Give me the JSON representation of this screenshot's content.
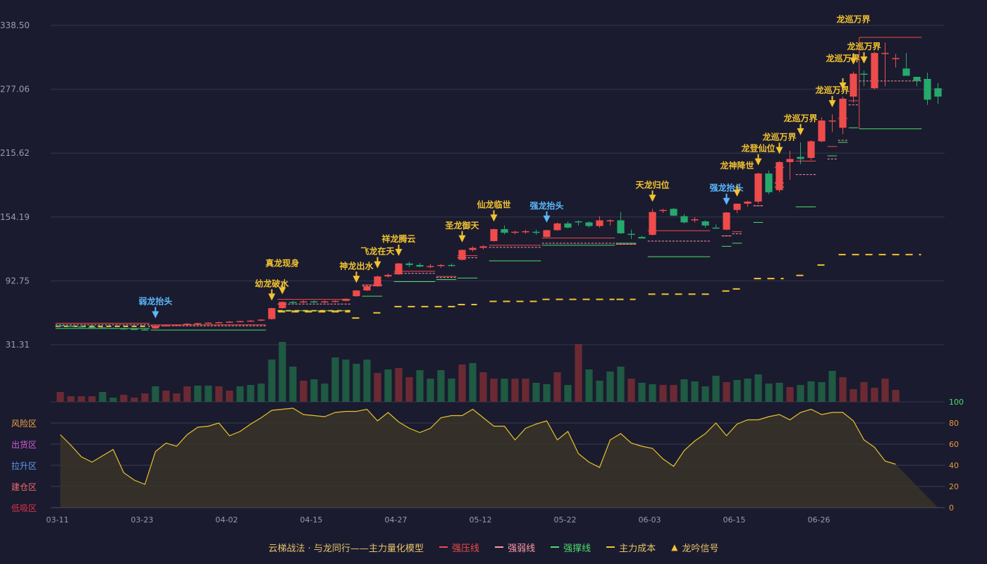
{
  "chart_data": {
    "type": "candlestick",
    "price_axis": {
      "ticks": [
        "338.50",
        "277.06",
        "215.62",
        "154.19",
        "92.75",
        "31.31"
      ],
      "min": 31.31,
      "max": 338.5
    },
    "x_ticks": [
      {
        "label": "03-11",
        "i": 0
      },
      {
        "label": "03-23",
        "i": 8
      },
      {
        "label": "04-02",
        "i": 16
      },
      {
        "label": "04-15",
        "i": 24
      },
      {
        "label": "04-27",
        "i": 32
      },
      {
        "label": "05-12",
        "i": 40
      },
      {
        "label": "05-22",
        "i": 48
      },
      {
        "label": "06-03",
        "i": 56
      },
      {
        "label": "06-15",
        "i": 64
      },
      {
        "label": "06-26",
        "i": 72
      }
    ],
    "candles": [
      [
        50,
        51,
        49,
        49.5
      ],
      [
        49.5,
        50,
        48.5,
        49
      ],
      [
        49,
        49.5,
        48,
        48.5
      ],
      [
        48.5,
        49,
        47.5,
        48
      ],
      [
        48,
        48.5,
        47,
        47.5
      ],
      [
        47.5,
        48,
        46.5,
        47
      ],
      [
        47,
        47.5,
        46,
        46.5
      ],
      [
        46.5,
        47,
        45.5,
        46
      ],
      [
        46,
        46.5,
        45,
        45.5
      ],
      [
        47,
        50,
        46.5,
        49.5
      ],
      [
        49.5,
        51,
        49,
        50
      ],
      [
        50,
        51,
        49.5,
        50.5
      ],
      [
        50.5,
        52,
        50,
        51.5
      ],
      [
        51.5,
        52.5,
        51,
        52
      ],
      [
        52,
        53,
        51.5,
        52.5
      ],
      [
        52.5,
        53.5,
        52,
        53
      ],
      [
        53,
        54,
        52.5,
        53.5
      ],
      [
        53.5,
        54.5,
        53,
        54
      ],
      [
        54,
        55,
        53.5,
        54.5
      ],
      [
        54.5,
        56,
        54,
        55.5
      ],
      [
        56,
        67,
        55.5,
        66.5
      ],
      [
        66.5,
        73,
        66,
        72.5
      ],
      [
        72.5,
        73.5,
        70,
        72
      ],
      [
        72,
        74,
        71.5,
        73
      ],
      [
        73,
        74,
        71.5,
        72.5
      ],
      [
        72.5,
        74,
        71.5,
        73
      ],
      [
        73,
        74,
        72,
        73.5
      ],
      [
        73.5,
        76,
        73,
        75.5
      ],
      [
        78,
        84,
        77.5,
        83.5
      ],
      [
        83.5,
        88,
        83,
        87.5
      ],
      [
        87.5,
        98,
        87,
        97
      ],
      [
        97,
        100,
        96,
        98.5
      ],
      [
        99,
        110,
        98.5,
        109.5
      ],
      [
        109.5,
        111,
        106,
        108
      ],
      [
        108,
        110,
        106,
        106.5
      ],
      [
        106.5,
        109,
        105,
        107
      ],
      [
        107,
        109,
        105.5,
        108
      ],
      [
        108,
        109.5,
        106.5,
        107.5
      ],
      [
        113,
        123,
        112.5,
        122.5
      ],
      [
        122.5,
        126,
        121,
        124.5
      ],
      [
        124.5,
        127,
        123,
        126
      ],
      [
        131,
        143,
        130.5,
        142.5
      ],
      [
        142.5,
        146,
        137.5,
        139
      ],
      [
        139,
        141,
        137.5,
        140
      ],
      [
        140,
        142,
        138,
        140.5
      ],
      [
        140,
        142,
        137,
        139.5
      ],
      [
        135,
        142,
        134.5,
        141.5
      ],
      [
        141.5,
        149,
        141,
        148
      ],
      [
        148,
        150,
        143,
        144
      ],
      [
        150,
        151,
        146,
        149
      ],
      [
        149,
        150,
        144,
        145.5
      ],
      [
        145.5,
        155,
        144,
        151
      ],
      [
        151,
        152,
        146,
        151
      ],
      [
        151,
        159,
        138,
        138.5
      ],
      [
        138,
        142,
        133,
        137
      ],
      [
        135,
        136,
        133.5,
        133.5
      ],
      [
        137,
        162,
        136.5,
        159
      ],
      [
        160,
        162,
        158,
        161
      ],
      [
        162,
        163,
        155,
        155.5
      ],
      [
        155,
        157,
        148,
        149
      ],
      [
        152,
        154,
        149,
        152
      ],
      [
        150,
        151,
        144,
        146
      ],
      [
        144,
        147,
        143,
        143.5
      ],
      [
        142,
        159,
        141.5,
        158.5
      ],
      [
        161,
        166,
        158,
        167
      ],
      [
        167,
        170,
        164,
        169
      ],
      [
        169,
        197,
        167,
        196
      ],
      [
        196,
        199,
        176,
        178
      ],
      [
        180,
        208,
        178,
        207
      ],
      [
        207,
        218,
        190,
        210
      ],
      [
        212,
        226,
        205,
        210
      ],
      [
        211,
        228,
        209,
        227
      ],
      [
        227,
        250,
        226,
        247
      ],
      [
        247,
        253,
        236,
        247
      ],
      [
        240,
        270,
        234,
        268
      ],
      [
        270,
        294,
        264,
        292
      ],
      [
        292,
        295,
        280,
        291
      ],
      [
        278,
        313,
        277,
        312
      ],
      [
        312,
        322,
        280,
        312
      ],
      [
        307,
        311,
        298,
        307
      ],
      [
        297,
        312,
        295,
        290
      ],
      [
        289,
        289,
        280,
        285
      ],
      [
        287,
        293,
        262,
        267
      ],
      [
        278,
        283,
        263,
        270
      ]
    ],
    "volume": [
      [
        14,
        "r"
      ],
      [
        8,
        "r"
      ],
      [
        8,
        "r"
      ],
      [
        8,
        "r"
      ],
      [
        14,
        "g"
      ],
      [
        6,
        "g"
      ],
      [
        10,
        "r"
      ],
      [
        6,
        "r"
      ],
      [
        12,
        "r"
      ],
      [
        22,
        "g"
      ],
      [
        16,
        "r"
      ],
      [
        12,
        "r"
      ],
      [
        22,
        "r"
      ],
      [
        23,
        "g"
      ],
      [
        23,
        "g"
      ],
      [
        22,
        "r"
      ],
      [
        16,
        "r"
      ],
      [
        22,
        "g"
      ],
      [
        24,
        "g"
      ],
      [
        26,
        "g"
      ],
      [
        60,
        "g"
      ],
      [
        85,
        "g"
      ],
      [
        50,
        "g"
      ],
      [
        30,
        "r"
      ],
      [
        32,
        "g"
      ],
      [
        26,
        "g"
      ],
      [
        63,
        "g"
      ],
      [
        60,
        "g"
      ],
      [
        54,
        "g"
      ],
      [
        60,
        "g"
      ],
      [
        41,
        "r"
      ],
      [
        46,
        "g"
      ],
      [
        48,
        "r"
      ],
      [
        35,
        "r"
      ],
      [
        45,
        "g"
      ],
      [
        33,
        "g"
      ],
      [
        45,
        "g"
      ],
      [
        33,
        "g"
      ],
      [
        53,
        "r"
      ],
      [
        55,
        "g"
      ],
      [
        42,
        "r"
      ],
      [
        33,
        "r"
      ],
      [
        33,
        "g"
      ],
      [
        33,
        "r"
      ],
      [
        33,
        "r"
      ],
      [
        27,
        "g"
      ],
      [
        25,
        "g"
      ],
      [
        42,
        "r"
      ],
      [
        24,
        "g"
      ],
      [
        82,
        "r"
      ],
      [
        46,
        "g"
      ],
      [
        30,
        "g"
      ],
      [
        43,
        "g"
      ],
      [
        50,
        "g"
      ],
      [
        33,
        "r"
      ],
      [
        27,
        "g"
      ],
      [
        25,
        "g"
      ],
      [
        24,
        "r"
      ],
      [
        24,
        "r"
      ],
      [
        32,
        "g"
      ],
      [
        29,
        "g"
      ],
      [
        22,
        "g"
      ],
      [
        37,
        "g"
      ],
      [
        28,
        "r"
      ],
      [
        31,
        "g"
      ],
      [
        33,
        "g"
      ],
      [
        39,
        "g"
      ],
      [
        26,
        "g"
      ],
      [
        27,
        "g"
      ],
      [
        21,
        "r"
      ],
      [
        24,
        "g"
      ],
      [
        29,
        "g"
      ],
      [
        28,
        "g"
      ],
      [
        44,
        "g"
      ],
      [
        35,
        "r"
      ],
      [
        18,
        "r"
      ],
      [
        28,
        "r"
      ],
      [
        20,
        "r"
      ],
      [
        33,
        "r"
      ],
      [
        17,
        "r"
      ]
    ],
    "oscillator": [
      69,
      59,
      48,
      43,
      49,
      55,
      33,
      26,
      22,
      53,
      61,
      58,
      69,
      76,
      77,
      80,
      68,
      72,
      79,
      85,
      92,
      93,
      94,
      88,
      87,
      86,
      90,
      91,
      91,
      93,
      82,
      90,
      81,
      75,
      71,
      75,
      85,
      87,
      87,
      93,
      85,
      77,
      77,
      64,
      75,
      79,
      82,
      64,
      72,
      51,
      43,
      38,
      64,
      70,
      61,
      58,
      56,
      46,
      39,
      54,
      63,
      70,
      80,
      68,
      79,
      83,
      83,
      86,
      88,
      83,
      90,
      93,
      88,
      90,
      90,
      82,
      64,
      57,
      44,
      41
    ],
    "osc_axis": {
      "ticks": [
        100,
        80,
        60,
        40,
        20,
        0
      ]
    },
    "zones": [
      {
        "label": "风险区",
        "color": "#f2a64a"
      },
      {
        "label": "出货区",
        "color": "#d35bd8"
      },
      {
        "label": "拉升区",
        "color": "#5b9cf0"
      },
      {
        "label": "建仓区",
        "color": "#f06a6a"
      },
      {
        "label": "低吸区",
        "color": "#e0304a"
      }
    ],
    "signals": [
      {
        "i": 9,
        "label": "弱龙抬头",
        "color": "#5ab9ff",
        "row": 0
      },
      {
        "i": 20,
        "label": "幼龙破水",
        "color": "#f2c230",
        "row": 0
      },
      {
        "i": 21,
        "label": "真龙现身",
        "color": "#f2c230",
        "row": 1
      },
      {
        "i": 28,
        "label": "神龙出水",
        "color": "#f2c230",
        "row": 0
      },
      {
        "i": 30,
        "label": "飞龙在天",
        "color": "#f2c230",
        "row": 0
      },
      {
        "i": 32,
        "label": "祥龙腾云",
        "color": "#f2c230",
        "row": 0
      },
      {
        "i": 38,
        "label": "圣龙御天",
        "color": "#f2c230",
        "row": 0
      },
      {
        "i": 41,
        "label": "仙龙临世",
        "color": "#f2c230",
        "row": 0
      },
      {
        "i": 46,
        "label": "强龙抬头",
        "color": "#5ab9ff",
        "row": 0
      },
      {
        "i": 56,
        "label": "天龙归位",
        "color": "#f2c230",
        "row": 0
      },
      {
        "i": 63,
        "label": "强龙抬头",
        "color": "#5ab9ff",
        "row": 0
      },
      {
        "i": 64,
        "label": "龙神降世",
        "color": "#f2c230",
        "row": 1
      },
      {
        "i": 66,
        "label": "龙登仙位",
        "color": "#f2c230",
        "row": 0
      },
      {
        "i": 68,
        "label": "龙巡万界",
        "color": "#f2c230",
        "row": 0
      },
      {
        "i": 70,
        "label": "龙巡万界",
        "color": "#f2c230",
        "row": 0
      },
      {
        "i": 73,
        "label": "龙巡万界",
        "color": "#f2c230",
        "row": 0
      },
      {
        "i": 74,
        "label": "龙巡万界",
        "color": "#f2c230",
        "row": 1
      },
      {
        "i": 75,
        "label": "龙巡万界",
        "color": "#f2c230",
        "row": 2
      },
      {
        "i": 76,
        "label": "龙巡万界",
        "color": "#f2c230",
        "row": 0
      }
    ],
    "segments": [
      {
        "i0": 0,
        "i1": 8,
        "resist": 52,
        "weak": 50.5,
        "support": 47,
        "cost": 49
      },
      {
        "i0": 9,
        "i1": 19,
        "resist": 50.5,
        "weak": 49.5,
        "support": 45.5
      },
      {
        "i0": 21,
        "i1": 27,
        "resist": 75,
        "weak": 70.5,
        "support": 64,
        "cost": 64
      },
      {
        "i0": 29,
        "i1": 30,
        "resist": 89,
        "weak": 88,
        "support": 78
      },
      {
        "i0": 32,
        "i1": 35,
        "resist": 102,
        "weak": 100,
        "support": 92
      },
      {
        "i0": 36,
        "i1": 37,
        "resist": 97,
        "weak": 96,
        "support": 94
      },
      {
        "i0": 38,
        "i1": 39,
        "resist": 117,
        "weak": 115,
        "support": 95.5
      },
      {
        "i0": 41,
        "i1": 45,
        "resist": 127,
        "weak": 125,
        "support": 112
      },
      {
        "i0": 46,
        "i1": 52,
        "resist": 134,
        "weak": 129,
        "support": 127
      },
      {
        "i0": 53,
        "i1": 54,
        "resist": 128,
        "weak": 128,
        "support": 129
      },
      {
        "i0": 56,
        "i1": 61,
        "resist": 141,
        "weak": 131,
        "support": 116
      },
      {
        "i0": 63,
        "i1": 63,
        "resist": 136,
        "weak": 136,
        "support": 126
      },
      {
        "i0": 64,
        "i1": 64,
        "resist": 140,
        "weak": 138,
        "support": 129
      },
      {
        "i0": 66,
        "i1": 66,
        "resist": 165,
        "weak": 165,
        "support": 149
      },
      {
        "i0": 68,
        "i1": 68,
        "resist": 202,
        "weak": 187,
        "support": 183
      },
      {
        "i0": 70,
        "i1": 71,
        "resist": 208,
        "weak": 195,
        "support": 164
      },
      {
        "i0": 73,
        "i1": 73,
        "resist": 222,
        "weak": 210,
        "support": 213
      },
      {
        "i0": 74,
        "i1": 74,
        "resist": 249,
        "weak": 228,
        "support": 226
      },
      {
        "i0": 75,
        "i1": 75,
        "resist": 266,
        "weak": 262,
        "support": 240
      },
      {
        "i0": 76,
        "i1": 81,
        "resist": 327,
        "weak": 285,
        "support": 239
      }
    ],
    "cost_line": [
      {
        "i0": 21,
        "i1": 27,
        "v": 63
      },
      {
        "i0": 28,
        "i1": 28,
        "v": 57
      },
      {
        "i0": 30,
        "i1": 30,
        "v": 62
      },
      {
        "i0": 32,
        "i1": 37,
        "v": 68
      },
      {
        "i0": 38,
        "i1": 39,
        "v": 70
      },
      {
        "i0": 41,
        "i1": 45,
        "v": 73
      },
      {
        "i0": 46,
        "i1": 52,
        "v": 75
      },
      {
        "i0": 53,
        "i1": 54,
        "v": 75
      },
      {
        "i0": 56,
        "i1": 61,
        "v": 80
      },
      {
        "i0": 63,
        "i1": 63,
        "v": 83
      },
      {
        "i0": 64,
        "i1": 64,
        "v": 85
      },
      {
        "i0": 66,
        "i1": 68,
        "v": 95
      },
      {
        "i0": 70,
        "i1": 70,
        "v": 98
      },
      {
        "i0": 72,
        "i1": 72,
        "v": 108
      },
      {
        "i0": 74,
        "i1": 81,
        "v": 118
      }
    ]
  },
  "legend": {
    "title": "云梯战法 · 与龙同行——主力量化模型",
    "items": [
      {
        "label": "强压线"
      },
      {
        "label": "强弱线"
      },
      {
        "label": "强撑线"
      },
      {
        "label": "主力成本"
      },
      {
        "label": "龙吟信号"
      }
    ]
  },
  "colors": {
    "background": "#1a1b2e",
    "up": "#ef4b4b",
    "down": "#26a96c",
    "signal_gold": "#f2c230",
    "signal_blue": "#5ab9ff"
  }
}
